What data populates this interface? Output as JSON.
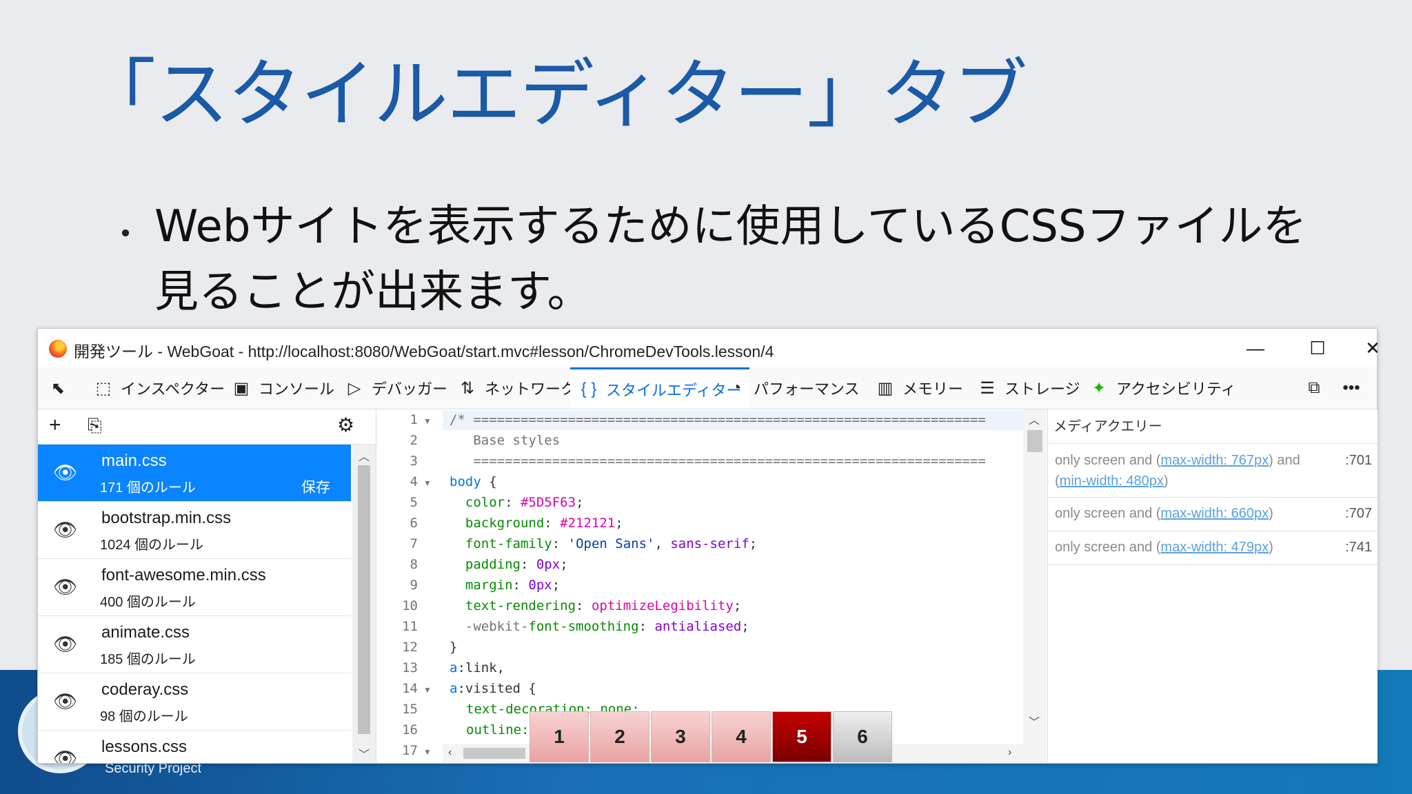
{
  "slide": {
    "title": "「スタイルエディター」タブ",
    "bullet_dot": "・",
    "bullet_text": "Webサイトを表示するために使用しているCSSファイルを見ることが出来ます。",
    "footer_text": "Security Project"
  },
  "window": {
    "title": "開発ツール - WebGoat - http://localhost:8080/WebGoat/start.mvc#lesson/ChromeDevTools.lesson/4",
    "controls": {
      "minimize": "—",
      "maximize": "☐",
      "close": "✕"
    }
  },
  "toolbar": {
    "picker_icon": "pick-element-icon",
    "tabs": [
      {
        "icon": "inspector-icon",
        "glyph": "⬚",
        "label": "インスペクター"
      },
      {
        "icon": "console-icon",
        "glyph": "▣",
        "label": "コンソール"
      },
      {
        "icon": "debugger-icon",
        "glyph": "▷",
        "label": "デバッガー"
      },
      {
        "icon": "network-icon",
        "glyph": "⇅",
        "label": "ネットワーク"
      },
      {
        "icon": "style-editor-icon",
        "glyph": "{ }",
        "label": "スタイルエディター"
      },
      {
        "icon": "performance-icon",
        "glyph": "◔",
        "label": "パフォーマンス"
      },
      {
        "icon": "memory-icon",
        "glyph": "▥",
        "label": "メモリー"
      },
      {
        "icon": "storage-icon",
        "glyph": "☰",
        "label": "ストレージ"
      },
      {
        "icon": "accessibility-icon",
        "glyph": "✦",
        "label": "アクセシビリティ"
      }
    ],
    "active_tab": "スタイルエディター",
    "right_icons": [
      "responsive-design-icon",
      "more-icon"
    ]
  },
  "sidebar": {
    "tools": {
      "add": "+",
      "import": "⎘",
      "settings": "⚙"
    },
    "files": [
      {
        "name": "main.css",
        "rules": "171 個のルール",
        "save": "保存",
        "selected": true
      },
      {
        "name": "bootstrap.min.css",
        "rules": "1024 個のルール"
      },
      {
        "name": "font-awesome.min.css",
        "rules": "400 個のルール"
      },
      {
        "name": "animate.css",
        "rules": "185 個のルール"
      },
      {
        "name": "coderay.css",
        "rules": "98 個のルール"
      },
      {
        "name": "lessons.css",
        "rules": ""
      }
    ]
  },
  "editor": {
    "line_numbers": [
      "1",
      "2",
      "3",
      "4",
      "5",
      "6",
      "7",
      "8",
      "9",
      "10",
      "11",
      "12",
      "13",
      "14",
      "15",
      "16",
      "17"
    ],
    "lines": {
      "l1": "/* =================================================================",
      "l2": "   Base styles",
      "l3": "   =================================================================",
      "l4_sel": "body",
      "l4_rest": " {",
      "l5_prop": "color",
      "l5_val": "#5D5F63",
      "l6_prop": "background",
      "l6_val": "#212121",
      "l7_prop": "font-family",
      "l7_str": "'Open Sans'",
      "l7_kw": "sans-serif",
      "l8_prop": "padding",
      "l8_val": "0px",
      "l9_prop": "margin",
      "l9_val": "0px",
      "l10_prop": "text-rendering",
      "l10_val": "optimizeLegibility",
      "l11_prefix": "-webkit-",
      "l11_prop": "font-smoothing",
      "l11_val": "antialiased",
      "l12": "}",
      "l13_sel": "a",
      "l13_rest": ":link,",
      "l14_sel": "a",
      "l14_rest": ":visited {",
      "l15": "text-decoration: none;",
      "l16": "outline:"
    }
  },
  "media": {
    "header": "メディアクエリー",
    "items": [
      {
        "pre": "only screen and (",
        "link1": "max-width: 767px",
        "mid": ") and (",
        "link2": "min-width: 480px",
        "post": ")",
        "line": ":701"
      },
      {
        "pre": "only screen and (",
        "link1": "max-width: 660px",
        "post": ")",
        "line": ":707"
      },
      {
        "pre": "only screen and (",
        "link1": "max-width: 479px",
        "post": ")",
        "line": ":741"
      }
    ]
  },
  "overlay": {
    "numbers": [
      "1",
      "2",
      "3",
      "4",
      "5",
      "6"
    ],
    "active": "5"
  },
  "colors": {
    "accent": "#0a84ff",
    "title_blue": "#1a5aa6",
    "selector": "#0074e8",
    "property": "#058b00",
    "value": "#dd00a9"
  }
}
